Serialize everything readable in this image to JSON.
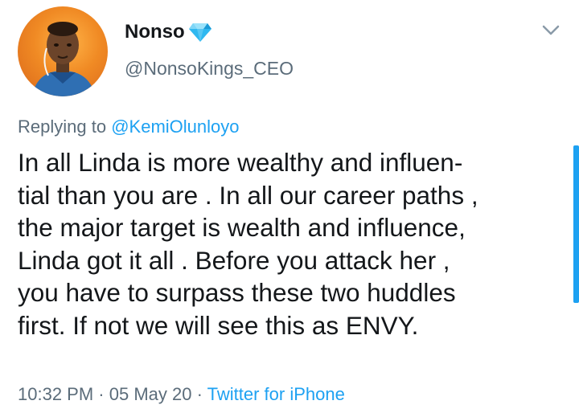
{
  "author": {
    "display_name": "Nonso",
    "handle": "@NonsoKings_CEO",
    "badge_icon": "diamond-icon",
    "avatar_icon": "avatar-photo"
  },
  "header": {
    "menu_icon": "chevron-down-icon"
  },
  "reply": {
    "prefix": "Replying to",
    "mention": "@KemiOlunloyo"
  },
  "tweet": {
    "lines": [
      "In all Linda is more wealthy and influen-",
      "tial than you are . In all our career paths ,",
      "the major target is wealth and influence,",
      "Linda got it all . Before you attack her ,",
      "you have to surpass these two huddles",
      "first. If not we will see this as ENVY."
    ]
  },
  "meta": {
    "time": "10:32 PM",
    "separator": "·",
    "date": "05 May 20",
    "source": "Twitter for iPhone"
  },
  "colors": {
    "link": "#1da1f2",
    "secondary_text": "#5b6c7a",
    "primary_text": "#14171a"
  }
}
